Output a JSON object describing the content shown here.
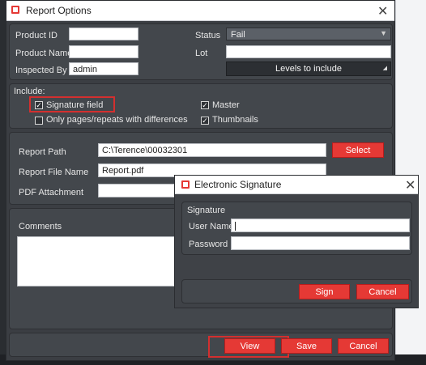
{
  "window": {
    "title": "Report Options",
    "close_icon": "close-icon"
  },
  "fields": {
    "product_id_label": "Product ID",
    "product_id_value": "",
    "status_label": "Status",
    "status_value": "Fail",
    "product_name_label": "Product Name",
    "product_name_value": "",
    "lot_label": "Lot",
    "lot_value": "",
    "inspected_by_label": "Inspected By",
    "inspected_by_value": "admin",
    "levels_button": "Levels to include"
  },
  "include": {
    "title": "Include:",
    "signature_field": {
      "label": "Signature field",
      "checked": true
    },
    "only_pages": {
      "label": "Only pages/repeats with differences",
      "checked": false
    },
    "master": {
      "label": "Master",
      "checked": true
    },
    "thumbnails": {
      "label": "Thumbnails",
      "checked": true
    }
  },
  "report": {
    "path_label": "Report Path",
    "path_value": "C:\\Terence\\00032301",
    "select_button": "Select",
    "file_name_label": "Report File Name",
    "file_name_value": "Report.pdf",
    "pdf_attachment_label": "PDF Attachment",
    "pdf_attachment_value": ""
  },
  "comments": {
    "label": "Comments",
    "value": ""
  },
  "footer": {
    "view_button": "View",
    "save_button": "Save",
    "cancel_button": "Cancel"
  },
  "signature_dialog": {
    "title": "Electronic Signature",
    "group_label": "Signature",
    "user_name_label": "User Name",
    "user_name_value": "",
    "password_label": "Password",
    "password_value": "",
    "sign_button": "Sign",
    "cancel_button": "Cancel"
  },
  "colors": {
    "accent": "#e53935",
    "panel": "#43474c",
    "window_bg": "#3b3e43"
  }
}
